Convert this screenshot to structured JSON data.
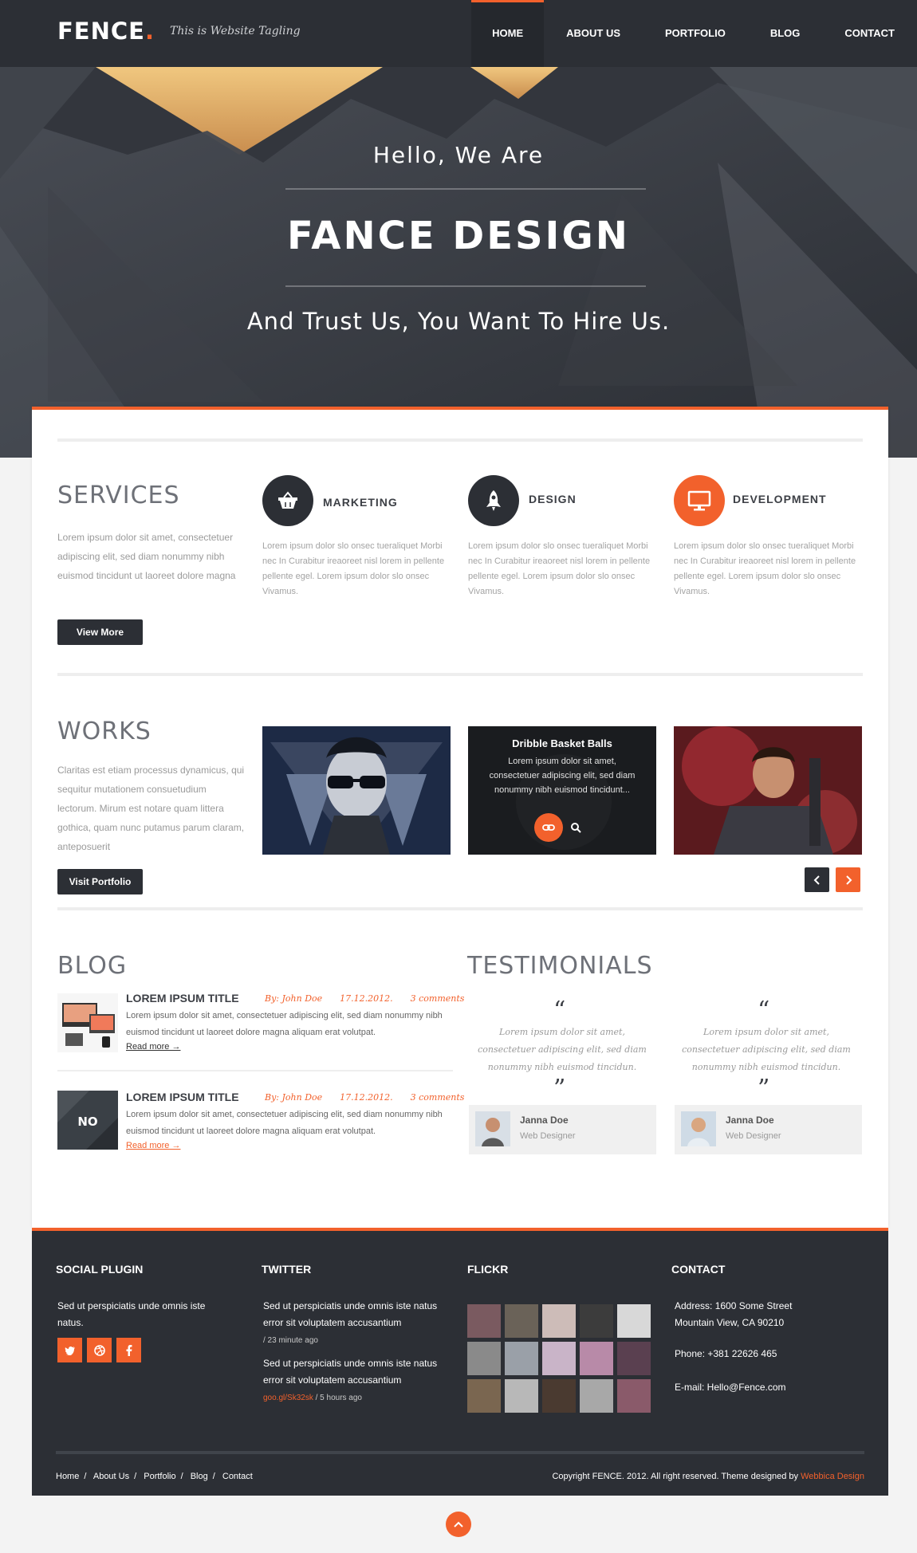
{
  "header": {
    "logo": "FENCE",
    "logo_dot": ".",
    "tagline": "This is Website Tagling",
    "nav": [
      "HOME",
      "ABOUT US",
      "PORTFOLIO",
      "BLOG",
      "CONTACT"
    ],
    "active_nav": "HOME"
  },
  "hero": {
    "hello": "Hello, We Are",
    "title": "FANCE DESIGN",
    "subtitle": "And Trust Us, You Want To Hire Us."
  },
  "services": {
    "title": "SERVICES",
    "text": "Lorem ipsum dolor sit amet, consectetuer adipiscing elit, sed diam nonummy nibh euismod tincidunt ut laoreet dolore magna",
    "button": "View More",
    "items": [
      {
        "title": "MARKETING",
        "icon": "basket-icon",
        "text": "Lorem ipsum dolor slo onsec tueraliquet Morbi nec In Curabitur ireaoreet nisl lorem in pellente pellente egel. Lorem ipsum dolor slo onsec Vivamus."
      },
      {
        "title": "DESIGN",
        "icon": "rocket-icon",
        "text": "Lorem ipsum dolor slo onsec tueraliquet Morbi nec In Curabitur ireaoreet nisl lorem in pellente pellente egel. Lorem ipsum dolor slo onsec Vivamus."
      },
      {
        "title": "DEVELOPMENT",
        "icon": "monitor-icon",
        "text": "Lorem ipsum dolor slo onsec tueraliquet Morbi nec In Curabitur ireaoreet nisl lorem in pellente pellente egel. Lorem ipsum dolor slo onsec Vivamus."
      }
    ]
  },
  "works": {
    "title": "WORKS",
    "text": "Claritas est etiam processus dynamicus, qui sequitur mutationem consuetudium lectorum. Mirum est notare quam littera gothica, quam nunc putamus parum claram, anteposuerit",
    "button": "Visit Portfolio",
    "overlay_title": "Dribble Basket Balls",
    "overlay_text": "Lorem ipsum dolor sit amet, consectetuer adipiscing elit, sed diam nonummy nibh euismod tincidunt..."
  },
  "blog": {
    "title": "BLOG",
    "posts": [
      {
        "title": "LOREM IPSUM TITLE",
        "author": "By: John Doe",
        "date": "17.12.2012.",
        "comments": "3 comments",
        "text": "Lorem ipsum dolor sit amet, consectetuer adipiscing elit, sed diam nonummy nibh euismod tincidunt ut laoreet dolore magna aliquam erat volutpat.",
        "read_more": "Read more →"
      },
      {
        "title": "LOREM IPSUM TITLE",
        "author": "By: John Doe",
        "date": "17.12.2012.",
        "comments": "3 comments",
        "text": "Lorem ipsum dolor sit amet, consectetuer adipiscing elit, sed diam nonummy nibh euismod tincidunt ut laoreet dolore magna aliquam erat volutpat.",
        "read_more": "Read more →",
        "thumb_label": "NO"
      }
    ]
  },
  "testimonials": {
    "title": "TESTIMONIALS",
    "open_quote": "“",
    "close_quote": "”",
    "items": [
      {
        "text": "Lorem ipsum dolor sit amet, consectetuer adipiscing elit, sed diam nonummy nibh euismod tincidun.",
        "name": "Janna Doe",
        "role": "Web Designer"
      },
      {
        "text": "Lorem ipsum dolor sit amet, consectetuer adipiscing elit, sed diam nonummy nibh euismod tincidun.",
        "name": "Janna Doe",
        "role": "Web Designer"
      }
    ]
  },
  "footer": {
    "social": {
      "title": "SOCIAL PLUGIN",
      "text": "Sed ut perspiciatis unde omnis iste natus."
    },
    "twitter": {
      "title": "TWITTER",
      "tweets": [
        {
          "text": "Sed ut perspiciatis unde omnis iste natus error sit voluptatem accusantium",
          "time": "/ 23 minute ago"
        },
        {
          "text": "Sed ut perspiciatis unde omnis iste natus error sit voluptatem accusantium",
          "link": "goo.gl/Sk32sk",
          "time": " / 5 hours ago"
        }
      ]
    },
    "flickr": {
      "title": "FLICKR"
    },
    "contact": {
      "title": "CONTACT",
      "address_1": "Address: 1600 Some Street",
      "address_2": "Mountain View, CA 90210",
      "phone": "Phone: +381 22626 465",
      "email": "E-mail:  Hello@Fence.com"
    },
    "bottom_nav": [
      "Home",
      "About Us",
      "Portfolio",
      "Blog",
      "Contact"
    ],
    "copyright": "Copyright  FENCE. 2012. All right reserved. Theme designed by ",
    "designer": "Webbica Design"
  },
  "colors": {
    "accent": "#f2612c",
    "dark": "#2c2f35"
  }
}
